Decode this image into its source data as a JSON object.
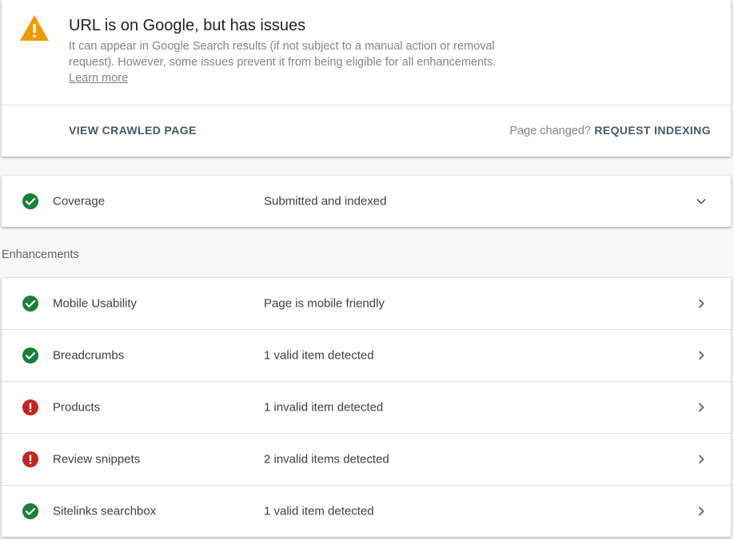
{
  "status": {
    "title": "URL is on Google, but has issues",
    "description": "It can appear in Google Search results (if not subject to a manual action or removal request). However, some issues prevent it from being eligible for all enhancements.",
    "learn_more": "Learn more",
    "view_crawled": "VIEW CRAWLED PAGE",
    "page_changed": "Page changed?",
    "request_indexing": "REQUEST INDEXING",
    "icon": "warning-icon",
    "icon_color": "#f29900"
  },
  "coverage": {
    "label": "Coverage",
    "value": "Submitted and indexed",
    "status": "valid",
    "icon": "chevron-down-icon"
  },
  "enhancements": {
    "section_label": "Enhancements",
    "items": [
      {
        "label": "Mobile Usability",
        "value": "Page is mobile friendly",
        "status": "valid"
      },
      {
        "label": "Breadcrumbs",
        "value": "1 valid item detected",
        "status": "valid"
      },
      {
        "label": "Products",
        "value": "1 invalid item detected",
        "status": "error"
      },
      {
        "label": "Review snippets",
        "value": "2 invalid items detected",
        "status": "error"
      },
      {
        "label": "Sitelinks searchbox",
        "value": "1 valid item detected",
        "status": "valid"
      }
    ]
  },
  "colors": {
    "valid": "#188038",
    "error": "#c5221f",
    "warning": "#f29900",
    "action_text": "#455a64"
  }
}
